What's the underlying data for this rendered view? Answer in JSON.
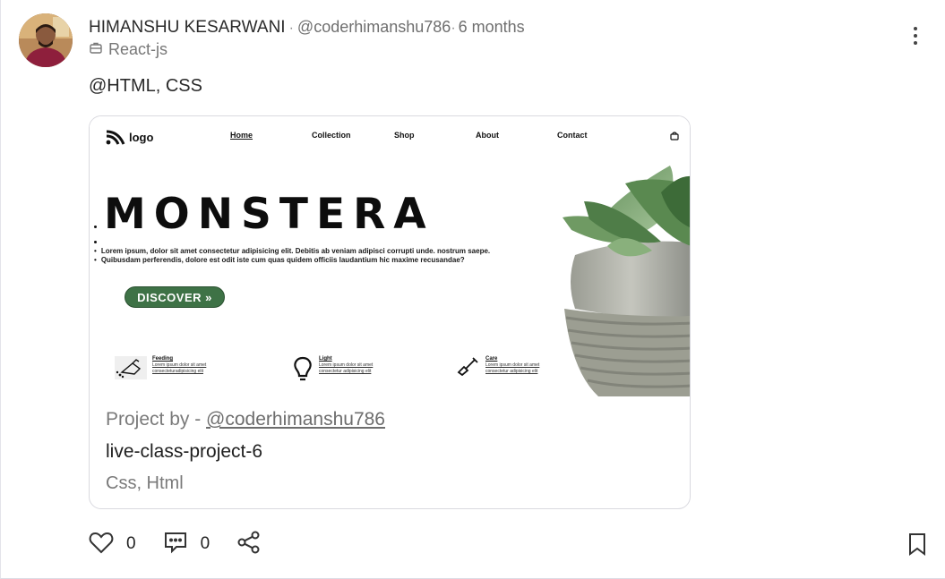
{
  "post": {
    "author": "HIMANSHU KESARWANI",
    "handle": "@coderhimanshu786",
    "separator": "·",
    "time": "6 months",
    "category": "React-js",
    "text": "@HTML, CSS"
  },
  "preview": {
    "logo_text": "logo",
    "nav": [
      "Home",
      "Collection",
      "Shop",
      "About",
      "Contact"
    ],
    "heading": "MONSTERA",
    "bullets": [
      "Lorem ipsum, dolor sit amet consectetur adipisicing elit. Debitis ab veniam adipisci corrupti unde. nostrum saepe.",
      "Quibusdam perferendis, dolore est odit iste cum quas quidem officiis laudantium hic maxime recusandae?"
    ],
    "cta": "DISCOVER »",
    "features": [
      {
        "title": "Feeding",
        "desc": "Lorem ipsum dolor sit amet consecteturadipisicing elit",
        "icon": "watering-can-icon"
      },
      {
        "title": "Light",
        "desc": "Lorem ipsum dolor sit amet consectetur adipisicing elit",
        "icon": "lightbulb-icon"
      },
      {
        "title": "Care",
        "desc": "Lorem ipsum dolor sit amet consectetur adipisicing elit",
        "icon": "shovel-icon"
      }
    ],
    "accent_color": "#3e7246"
  },
  "project": {
    "by_label": "Project by - ",
    "by_handle": "@coderhimanshu786",
    "title": "live-class-project-6",
    "tags": "Css, Html"
  },
  "actions": {
    "likes": "0",
    "comments": "0"
  },
  "icons": [
    "more-vertical-icon",
    "briefcase-icon",
    "heart-icon",
    "comment-icon",
    "share-icon",
    "bookmark-icon"
  ]
}
